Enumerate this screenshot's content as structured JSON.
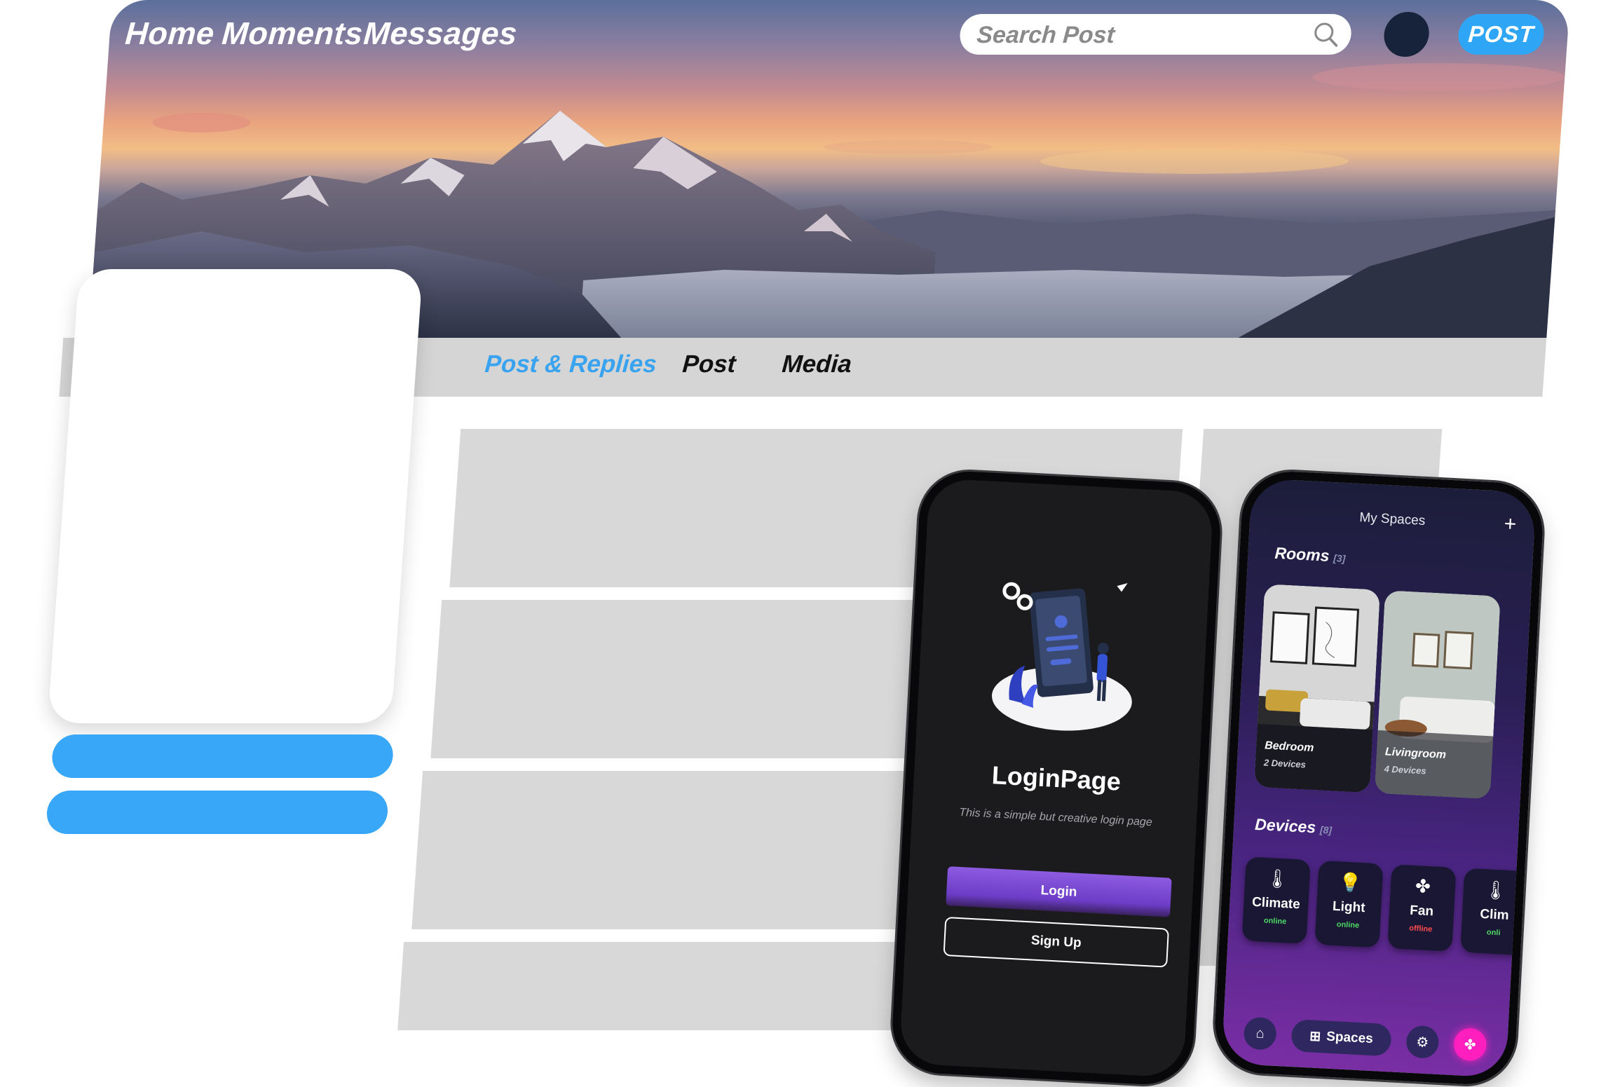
{
  "nav": {
    "links": [
      "Home",
      "Moments",
      "Messages"
    ],
    "search_placeholder": "Search Post",
    "post_label": "POST"
  },
  "tabs": [
    "Post & Replies",
    "Post",
    "Media"
  ],
  "colors": {
    "accent": "#3aa3ef",
    "card_grey": "#d8d8d8",
    "login_button": "#7a4ad6",
    "online": "#4cd964",
    "offline": "#ff4d4d",
    "pink_action": "#ff1fbf"
  },
  "login_app": {
    "title": "LoginPage",
    "description": "This is a simple but creative login page",
    "login_label": "Login",
    "signup_label": "Sign Up"
  },
  "smart_home_app": {
    "header": "My Spaces",
    "add_icon": "plus-icon",
    "rooms_label": "Rooms",
    "rooms_count": "[3]",
    "rooms": [
      {
        "name": "Bedroom",
        "devices": "2 Devices"
      },
      {
        "name": "Livingroom",
        "devices": "4 Devices"
      }
    ],
    "devices_label": "Devices",
    "devices_count": "[8]",
    "devices": [
      {
        "name": "Climate",
        "status": "online",
        "icon": "thermometer-icon"
      },
      {
        "name": "Light",
        "status": "online",
        "icon": "bulb-icon"
      },
      {
        "name": "Fan",
        "status": "offline",
        "icon": "fan-icon"
      },
      {
        "name": "Clim",
        "status": "onli",
        "icon": "thermometer-icon"
      }
    ],
    "bottom_nav": {
      "spaces_label": "Spaces",
      "icons": [
        "home-icon",
        "spaces-icon",
        "settings-icon",
        "fan-action-icon"
      ]
    }
  }
}
